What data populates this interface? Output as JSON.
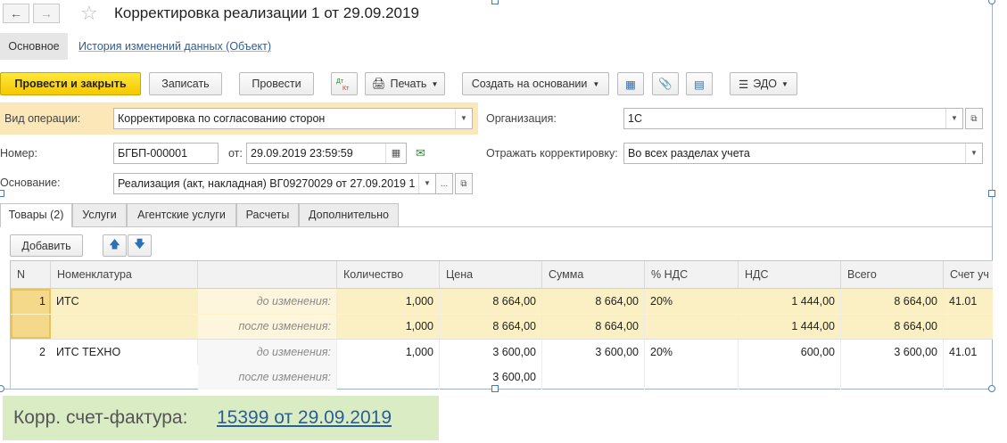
{
  "window": {
    "title": "Корректировка реализации 1 от 29.09.2019"
  },
  "top_tabs": {
    "main": "Основное",
    "history": "История изменений данных (Объект)"
  },
  "toolbar": {
    "post_close": "Провести и закрыть",
    "save": "Записать",
    "post": "Провести",
    "print": "Печать",
    "create_based": "Создать на основании",
    "edo": "ЭДО"
  },
  "form": {
    "operation_label": "Вид операции:",
    "operation_value": "Корректировка по согласованию сторон",
    "org_label": "Организация:",
    "org_value": "1С",
    "number_label": "Номер:",
    "number_value": "БГБП-000001",
    "date_label": "от:",
    "date_value": "29.09.2019 23:59:59",
    "reflect_label": "Отражать корректировку:",
    "reflect_value": "Во всех разделах учета",
    "basis_label": "Основание:",
    "basis_value": "Реализация (акт, накладная) ВГ09270029 от 27.09.2019 1",
    "ellipsis": "..."
  },
  "tabs": [
    "Товары (2)",
    "Услуги",
    "Агентские услуги",
    "Расчеты",
    "Дополнительно"
  ],
  "table_toolbar": {
    "add": "Добавить"
  },
  "table": {
    "headers": [
      "N",
      "Номенклатура",
      "Количество",
      "Цена",
      "Сумма",
      "% НДС",
      "НДС",
      "Всего",
      "Счет уч"
    ],
    "rows": [
      {
        "n": "1",
        "name": "ИТС",
        "before": {
          "label": "до изменения:",
          "qty": "1,000",
          "price": "8 664,00",
          "sum": "8 664,00",
          "vat_rate": "20%",
          "vat": "1 444,00",
          "total": "8 664,00",
          "account": "41.01"
        },
        "after": {
          "label": "после изменения:",
          "qty": "1,000",
          "price": "8 664,00",
          "sum": "8 664,00",
          "vat_rate": "",
          "vat": "1 444,00",
          "total": "8 664,00",
          "account": ""
        }
      },
      {
        "n": "2",
        "name": "ИТС ТЕХНО",
        "before": {
          "label": "до изменения:",
          "qty": "1,000",
          "price": "3 600,00",
          "sum": "3 600,00",
          "vat_rate": "20%",
          "vat": "600,00",
          "total": "3 600,00",
          "account": "41.01"
        },
        "after": {
          "label": "после изменения:",
          "qty": "",
          "price": "3 600,00",
          "sum": "",
          "vat_rate": "",
          "vat": "",
          "total": "",
          "account": ""
        }
      }
    ]
  },
  "invoice": {
    "label": "Корр. счет-фактура:",
    "link": "15399 от 29.09.2019"
  },
  "colors": {
    "primary_button": "#f5c800",
    "selected_row": "#fbf0c4",
    "operation_highlight": "#fbe7b8",
    "invoice_bg": "#d9ecc4",
    "link": "#2b5e97"
  }
}
